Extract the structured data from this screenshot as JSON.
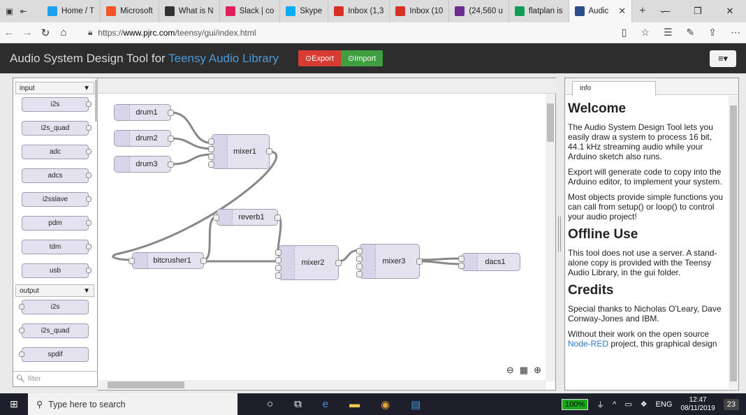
{
  "browser": {
    "tabs": [
      {
        "label": "Home / T",
        "color": "#1da1f2",
        "icon": "twitter-icon"
      },
      {
        "label": "Microsoft",
        "color": "#f35325",
        "icon": "microsoft-icon"
      },
      {
        "label": "What is N",
        "color": "#333333",
        "icon": "page-icon"
      },
      {
        "label": "Slack | co",
        "color": "#e01e5a",
        "icon": "slack-icon"
      },
      {
        "label": "Skype",
        "color": "#00aff0",
        "icon": "skype-icon"
      },
      {
        "label": "Inbox (1,3",
        "color": "#d93025",
        "icon": "gmail-icon"
      },
      {
        "label": "Inbox (10",
        "color": "#d93025",
        "icon": "gmail-icon"
      },
      {
        "label": "(24,560 u",
        "color": "#6c2c91",
        "icon": "mail-icon"
      },
      {
        "label": "flatplan is",
        "color": "#0f9d58",
        "icon": "sheets-icon"
      },
      {
        "label": "Audic",
        "color": "#2f4d8c",
        "icon": "audio-tool-icon",
        "active": true
      }
    ],
    "url_prefix": "https://",
    "url_domain": "www.pjrc.com",
    "url_path": "/teensy/gui/index.html"
  },
  "app": {
    "title_prefix": "Audio System Design Tool for ",
    "title_highlight": "Teensy Audio Library",
    "export_label": "Export",
    "import_label": "Import"
  },
  "palette": {
    "input_header": "input",
    "input_items": [
      "i2s",
      "i2s_quad",
      "adc",
      "adcs",
      "i2sslave",
      "pdm",
      "tdm",
      "usb"
    ],
    "output_header": "output",
    "output_items": [
      "i2s",
      "i2s_quad",
      "spdif"
    ],
    "filter_placeholder": "filter"
  },
  "nodes": {
    "drum1": "drum1",
    "drum2": "drum2",
    "drum3": "drum3",
    "mixer1": "mixer1",
    "reverb1": "reverb1",
    "bitcrusher1": "bitcrusher1",
    "mixer2": "mixer2",
    "mixer3": "mixer3",
    "dacs1": "dacs1"
  },
  "info": {
    "tab_label": "info",
    "h_welcome": "Welcome",
    "p1": "The Audio System Design Tool lets you easily draw a system to process 16 bit, 44.1 kHz streaming audio while your Arduino sketch also runs.",
    "p2": "Export will generate code to copy into the Arduino editor, to implement your system.",
    "p3": "Most objects provide simple functions you can call from setup() or loop() to control your audio project!",
    "h_offline": "Offline Use",
    "p4": "This tool does not use a server. A stand-alone copy is provided with the Teensy Audio Library, in the gui folder.",
    "h_credits": "Credits",
    "p5": "Special thanks to Nicholas O'Leary, Dave Conway-Jones and IBM.",
    "p6a": "Without their work on the open source ",
    "p6link": "Node-RED",
    "p6b": " project, this graphical design"
  },
  "taskbar": {
    "search_placeholder": "Type here to search",
    "battery": "100%",
    "lang": "ENG",
    "time": "12:47",
    "date": "08/11/2019",
    "notifications": "23"
  }
}
